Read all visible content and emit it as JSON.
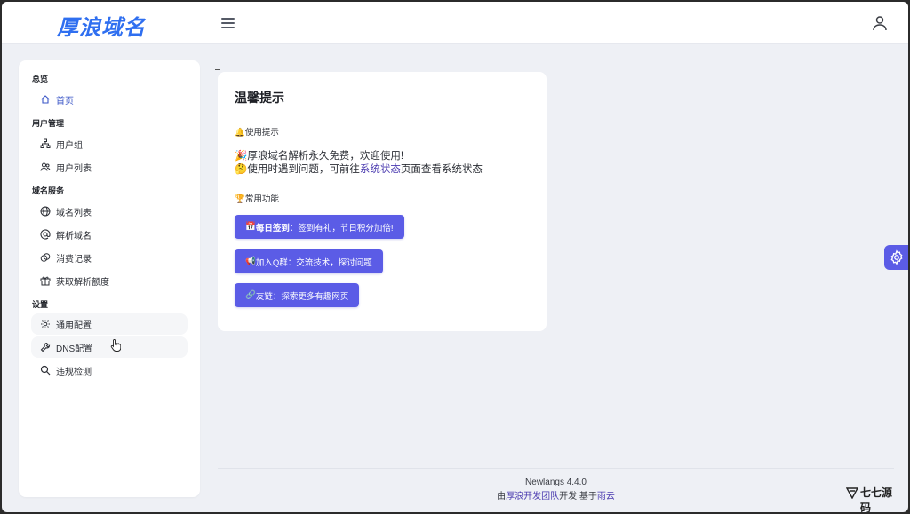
{
  "header": {
    "brand": "厚浪域名",
    "menu_icon": "hamburger-icon",
    "user_icon": "user-icon"
  },
  "sidebar": {
    "sections": [
      {
        "title": "总览",
        "items": [
          {
            "label": "首页",
            "icon": "home-icon",
            "active": true
          }
        ]
      },
      {
        "title": "用户管理",
        "items": [
          {
            "label": "用户组",
            "icon": "sitemap-icon"
          },
          {
            "label": "用户列表",
            "icon": "users-icon"
          }
        ]
      },
      {
        "title": "域名服务",
        "items": [
          {
            "label": "域名列表",
            "icon": "globe-icon"
          },
          {
            "label": "解析域名",
            "icon": "at-icon"
          },
          {
            "label": "消费记录",
            "icon": "coins-icon"
          },
          {
            "label": "获取解析额度",
            "icon": "gift-icon"
          }
        ]
      },
      {
        "title": "设置",
        "items": [
          {
            "label": "通用配置",
            "icon": "gear-icon"
          },
          {
            "label": "DNS配置",
            "icon": "wrench-icon"
          },
          {
            "label": "违规检测",
            "icon": "search-icon"
          }
        ]
      }
    ]
  },
  "card": {
    "title": "温馨提示",
    "usage_heading": "使用提示",
    "usage_icon": "bell-icon",
    "tip1": "厚浪域名解析永久免费，欢迎使用!",
    "tip1_icon": "party-popper-icon",
    "tip2_prefix": "使用时遇到问题，可前往",
    "tip2_link": "系统状态",
    "tip2_suffix": "页面查看系统状态",
    "tip2_icon": "thinking-face-icon",
    "features_heading": "常用功能",
    "features_icon": "trophy-icon",
    "buttons": [
      {
        "bold": "每日签到",
        "rest": "：签到有礼，节日积分加倍!",
        "icon": "calendar-icon"
      },
      {
        "bold": "加入Q群",
        "rest": "：交流技术，探讨问题",
        "icon": "megaphone-icon"
      },
      {
        "bold": "友链",
        "rest": "：探索更多有趣网页",
        "icon": "link-icon"
      }
    ]
  },
  "footer": {
    "version": "Newlangs 4.4.0",
    "cr_prefix": "由",
    "cr_team": "厚浪开发团队",
    "cr_middle": "开发 基于",
    "cr_cloud": "雨云"
  },
  "floating": {
    "settings_icon": "gear-icon"
  },
  "watermark": {
    "text": "七七源码",
    "icon": "logo-mark-icon"
  },
  "colors": {
    "brand": "#2f6ff0",
    "accent": "#5b5ce6",
    "link": "#4b3bb0",
    "background": "#eef0f5"
  }
}
